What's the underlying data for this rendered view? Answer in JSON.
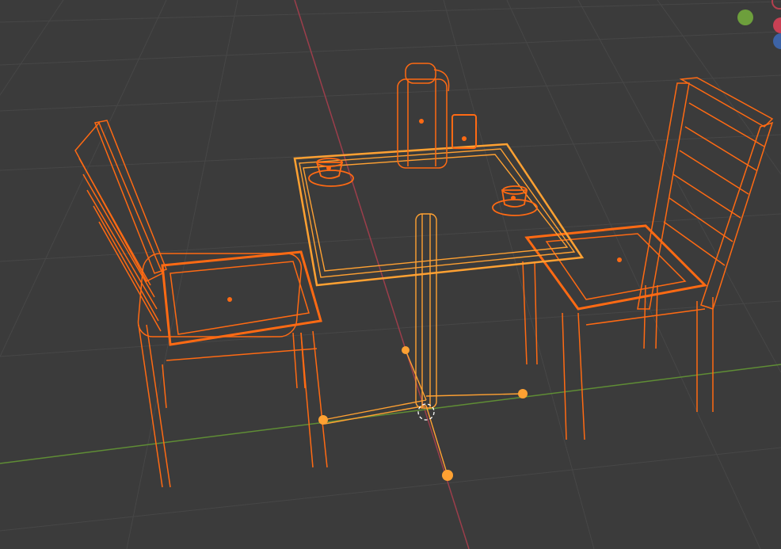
{
  "viewport": {
    "background": "#3b3b3b",
    "grid_color": "#444444",
    "x_axis_color": "#b3404e",
    "y_axis_color": "#6d9f3c",
    "selection_color": "#ff6a13",
    "active_color": "#ffa132"
  },
  "scene": {
    "objects": [
      {
        "name": "chair-left",
        "icon": "chair-icon"
      },
      {
        "name": "chair-right",
        "icon": "chair-icon"
      },
      {
        "name": "table",
        "icon": "table-icon"
      },
      {
        "name": "pitcher",
        "icon": "pitcher-icon"
      },
      {
        "name": "cup-left",
        "icon": "cup-icon"
      },
      {
        "name": "cup-right",
        "icon": "cup-icon"
      },
      {
        "name": "juice-box",
        "icon": "box-icon"
      }
    ]
  },
  "gizmo": {
    "y_color": "#6d9f3c",
    "x_color": "#c94054",
    "z_color": "#3d63a6"
  }
}
